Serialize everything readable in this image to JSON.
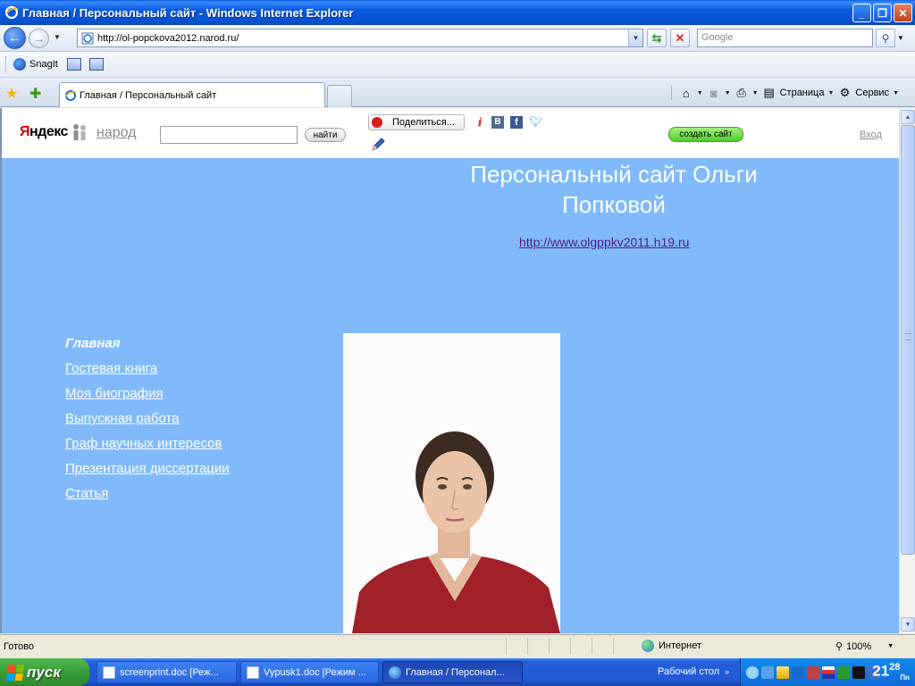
{
  "window": {
    "title": "Главная / Персональный сайт - Windows Internet Explorer",
    "buttons": {
      "minimize": "_",
      "maximize": "❐",
      "close": "✕"
    }
  },
  "navbar": {
    "url": "http://ol-popckova2012.narod.ru/",
    "search_placeholder": "Google"
  },
  "snagit_bar": {
    "label": "SnagIt"
  },
  "tabs": [
    {
      "label": "Главная / Персональный сайт",
      "active": true
    }
  ],
  "command_bar": {
    "page_label": "Страница",
    "tools_label": "Сервис"
  },
  "narod_header": {
    "logo_ya": "Я",
    "logo_rest": "ндекс",
    "narod_label": "народ",
    "search_value": "",
    "find_button": "найти",
    "share_button": "Поделиться...",
    "vk_label": "B",
    "fb_label": "f",
    "create_site_button": "создать сайт",
    "login_link": "Вход"
  },
  "page": {
    "title": "Персональный сайт Ольги Попковой",
    "link": "http://www.olgppkv2011.h19.ru",
    "menu": [
      {
        "label": "Главная",
        "current": true
      },
      {
        "label": "Гостевая книга",
        "current": false
      },
      {
        "label": "Моя биография",
        "current": false
      },
      {
        "label": "Выпускная работа",
        "current": false
      },
      {
        "label": "Граф научных интересов",
        "current": false
      },
      {
        "label": "Презентация диссертации",
        "current": false
      },
      {
        "label": "Статья",
        "current": false
      }
    ]
  },
  "statusbar": {
    "status": "Готово",
    "zone": "Интернет",
    "zoom": "100%"
  },
  "taskbar": {
    "start_label": "пуск",
    "tasks": [
      {
        "label": "screenprint.doc [Реж...",
        "active": false
      },
      {
        "label": "Vypusk1.doc [Режим ...",
        "active": false
      },
      {
        "label": "Главная / Персонал...",
        "active": true
      }
    ],
    "desktop_label": "Рабочий стол",
    "clock_hours": "21",
    "clock_minutes": "28",
    "clock_day": "Пн"
  },
  "colors": {
    "page_background": "#80bafb",
    "create_site_green": "#4fcf26",
    "yandex_red": "#e00000",
    "visited_link": "#551a8b"
  }
}
